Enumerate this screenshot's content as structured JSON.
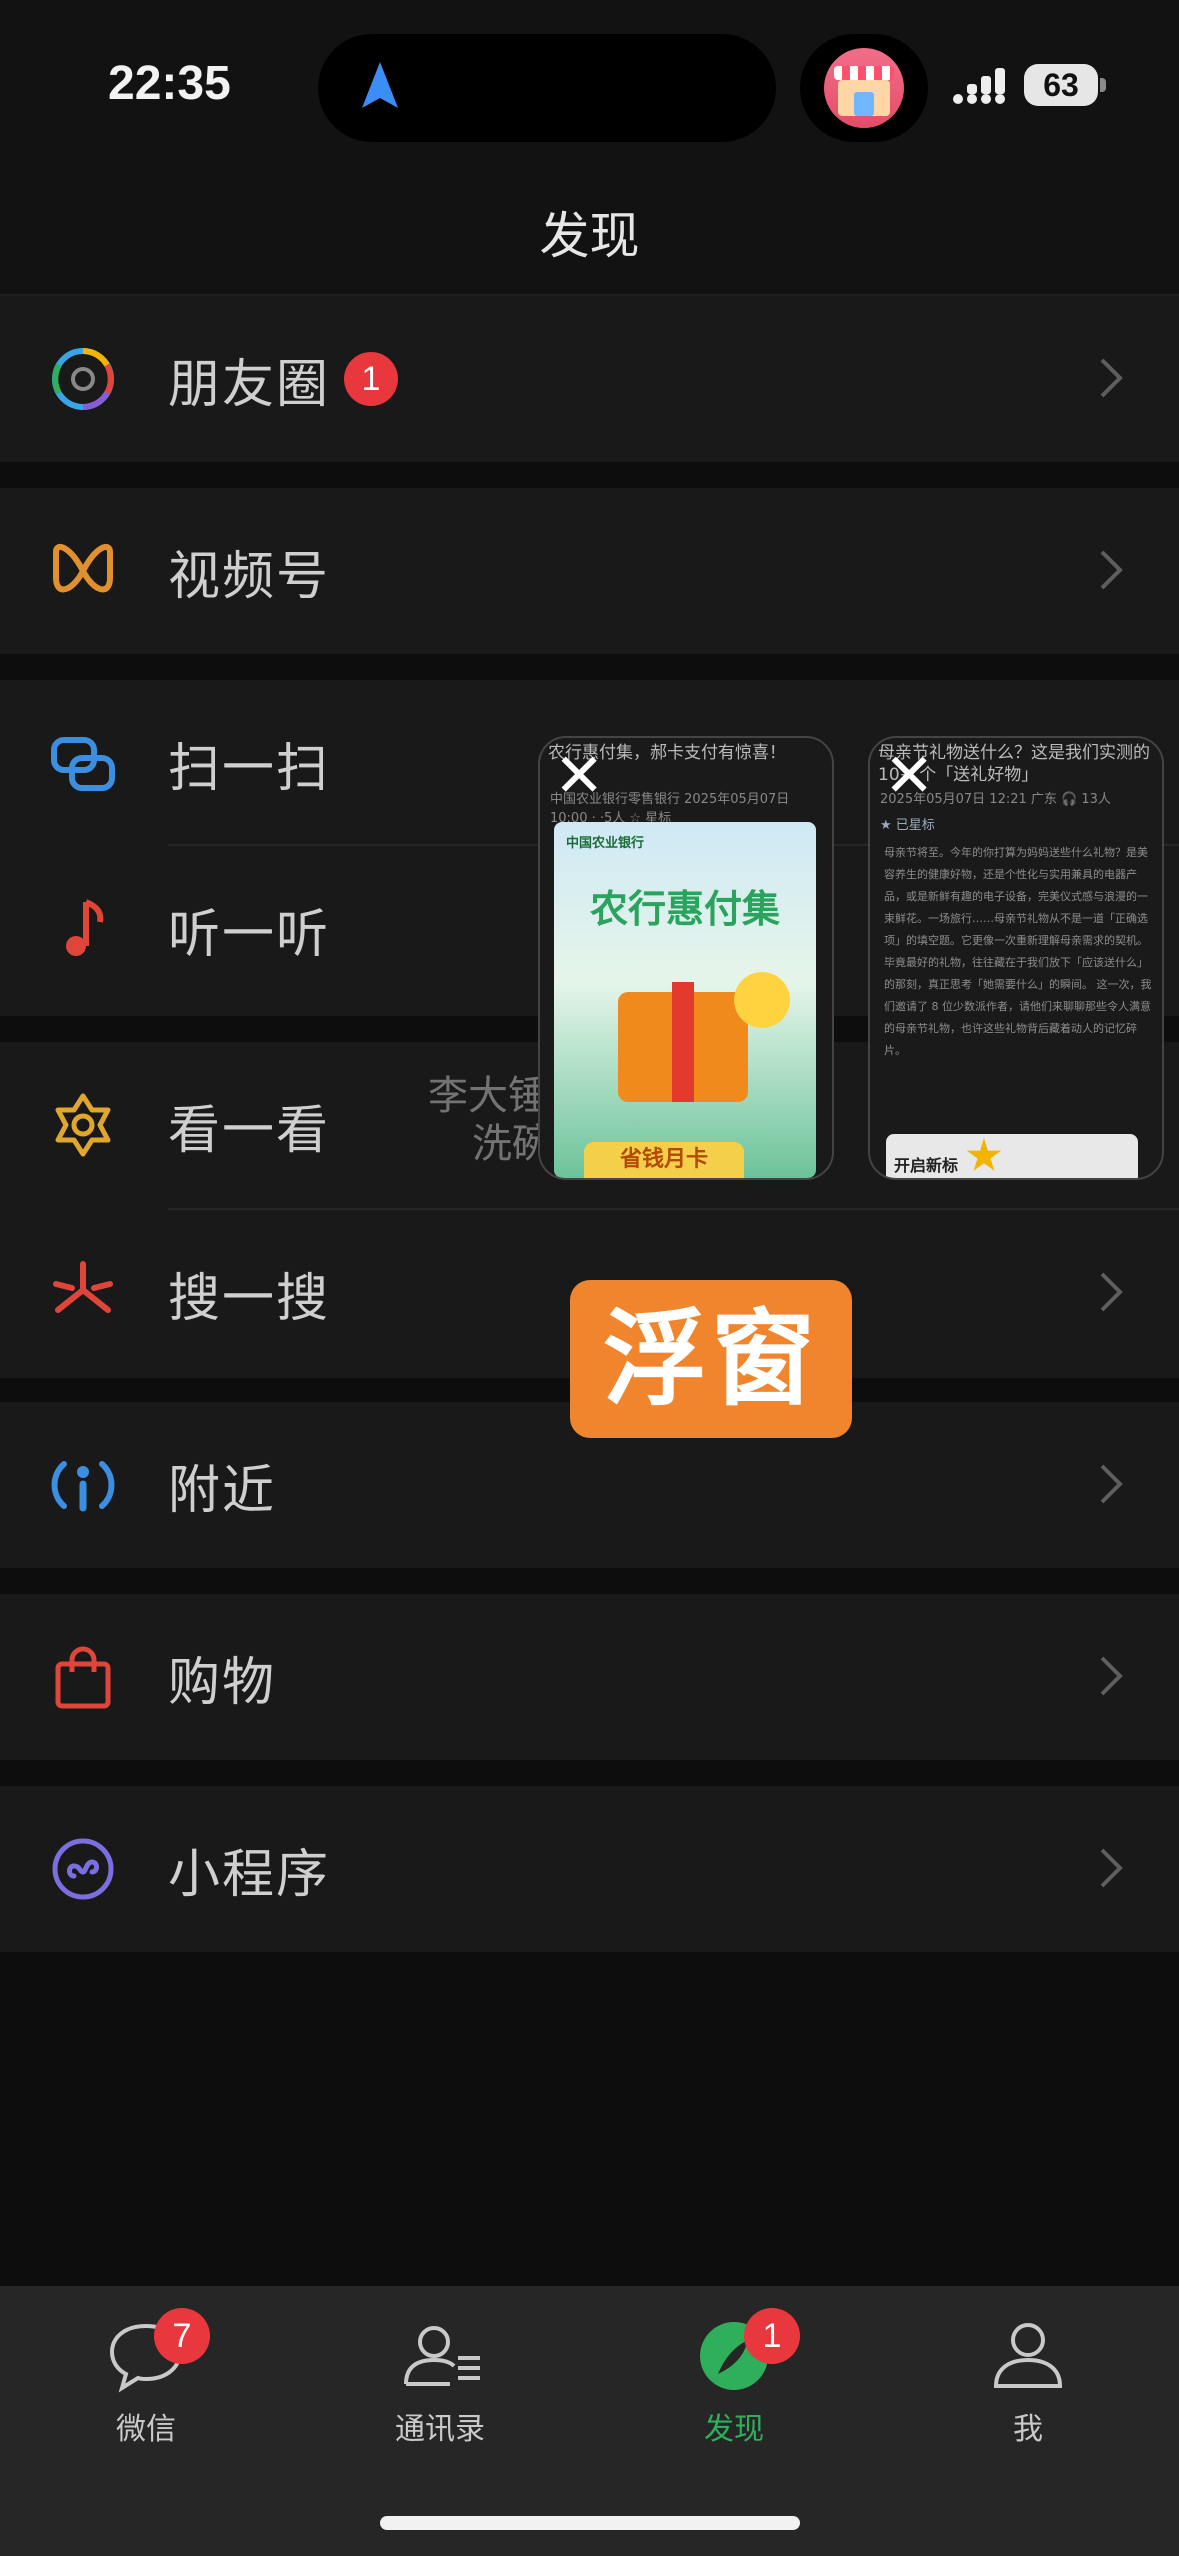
{
  "status": {
    "time": "22:35",
    "battery": "63"
  },
  "nav": {
    "title": "发现"
  },
  "menu": [
    {
      "label": "朋友圈",
      "icon": "moments-aperture-icon",
      "badge": "1"
    },
    {
      "label": "视频号",
      "icon": "channels-icon"
    },
    {
      "label": "扫一扫",
      "icon": "scan-icon"
    },
    {
      "label": "听一听",
      "icon": "music-note-icon"
    },
    {
      "label": "看一看",
      "icon": "top-stories-icon"
    },
    {
      "label": "搜一搜",
      "icon": "search-spark-icon"
    },
    {
      "label": "附近",
      "icon": "nearby-location-icon"
    },
    {
      "label": "购物",
      "icon": "shopping-bag-icon"
    },
    {
      "label": "小程序",
      "icon": "mini-program-icon"
    }
  ],
  "floating_windows": [
    {
      "header": "农行惠付集，郝卡支付有惊喜！",
      "meta": "中国农业银行零售银行 2025年05月07日 10:00  · ·5人  ☆ 星标",
      "poster_bank": "中国农业银行",
      "poster_title": "农行惠付集",
      "poster_foot": "省钱月卡"
    },
    {
      "header": "母亲节礼物送什么？这是我们实测的 10+ 个「送礼好物」",
      "meta": "2025年05月07日 12:21 广东  🎧 13人",
      "starred": "★ 已星标",
      "body": "母亲节将至。今年的你打算为妈妈送些什么礼物？是美容养生的健康好物，还是个性化与实用兼具的电器产品，或是新鲜有趣的电子设备，完美仪式感与浪漫的一束鲜花。一场旅行……母亲节礼物从不是一道「正确选项」的填空题。它更像一次重新理解母亲需求的契机。毕竟最好的礼物，往往藏在于我们放下「应该送什么」的那刻，真正思考「她需要什么」的瞬间。 这一次，我们邀请了 8 位少数派作者，请他们来聊聊那些令人满意的母亲节礼物，也许这些礼物背后藏着动人的记忆碎片。",
      "image_caption": "开启新标"
    }
  ],
  "ghost_text": [
    "李大锤",
    "洗碗"
  ],
  "overlay_label": "浮窗",
  "tabs": [
    {
      "label": "微信",
      "badge": "7",
      "icon": "chat-bubble-icon",
      "active": false
    },
    {
      "label": "通讯录",
      "badge": "",
      "icon": "contacts-icon",
      "active": false
    },
    {
      "label": "发现",
      "badge": "1",
      "icon": "discover-compass-icon",
      "active": true
    },
    {
      "label": "我",
      "badge": "",
      "icon": "me-person-icon",
      "active": false
    }
  ],
  "colors": {
    "accent_green": "#2fae5c",
    "badge_red": "#e8383d",
    "overlay_orange": "#f0852e"
  }
}
